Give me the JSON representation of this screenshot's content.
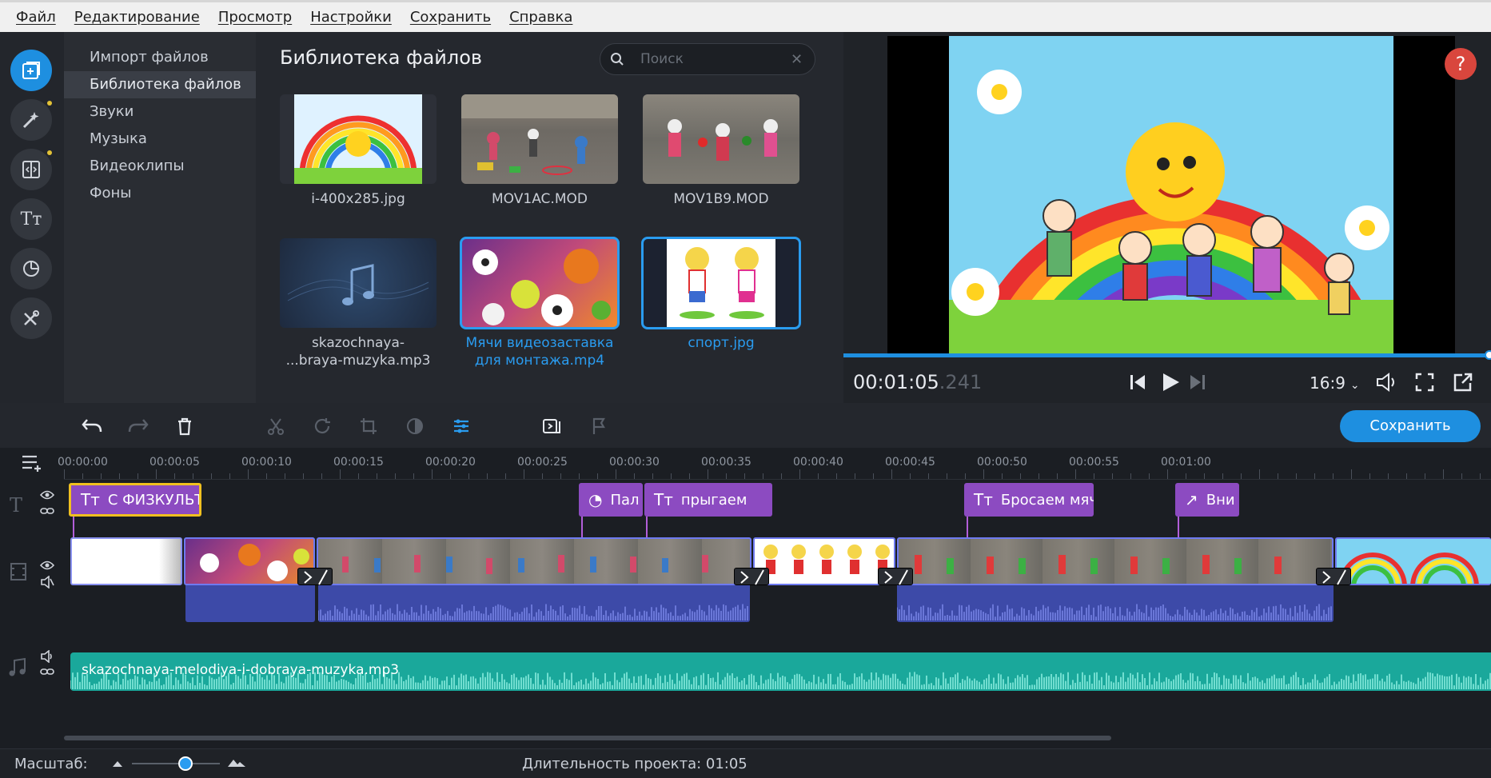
{
  "menu": [
    "Файл",
    "Редактирование",
    "Просмотр",
    "Настройки",
    "Сохранить",
    "Справка"
  ],
  "categories": [
    "Импорт файлов",
    "Библиотека файлов",
    "Звуки",
    "Музыка",
    "Видеоклипы",
    "Фоны"
  ],
  "icons": [
    "import-icon",
    "magic-wand-icon",
    "transitions-icon",
    "titles-icon",
    "stickers-icon",
    "tools-icon"
  ],
  "library": {
    "title": "Библиотека файлов",
    "search_placeholder": "Поиск",
    "files": [
      {
        "name": "i-400x285.jpg",
        "selected": false
      },
      {
        "name": "MOV1AC.MOD",
        "selected": false
      },
      {
        "name": "MOV1B9.MOD",
        "selected": false
      },
      {
        "name_line1": "skazochnaya-",
        "name_line2": "...braya-muzyka.mp3",
        "selected": false
      },
      {
        "name_line1": "Мячи видеозаставка",
        "name_line2": "для монтажа.mp4",
        "selected": true
      },
      {
        "name": "спорт.jpg",
        "selected": true
      }
    ]
  },
  "preview": {
    "help": "?",
    "timecode": "00:01:05",
    "timecode_ms": ".241",
    "aspect": "16:9",
    "progress": 1.0
  },
  "toolbar": {
    "save_label": "Сохранить"
  },
  "ruler": [
    "00:00:00",
    "00:00:05",
    "00:00:10",
    "00:00:15",
    "00:00:20",
    "00:00:25",
    "00:00:30",
    "00:00:35",
    "00:00:40",
    "00:00:45",
    "00:00:50",
    "00:00:55",
    "00:01:00"
  ],
  "title_clips": [
    {
      "label": "С ФИЗКУЛЬТ",
      "glyph": "Тт",
      "selected": true
    },
    {
      "label": "Пал",
      "glyph": "◔",
      "selected": false
    },
    {
      "label": "прыгаем",
      "glyph": "Тт",
      "selected": false
    },
    {
      "label": "Бросаем мяч",
      "glyph": "Тт",
      "selected": false
    },
    {
      "label": "Вни",
      "glyph": "↗",
      "selected": false
    }
  ],
  "music_track": {
    "label": "skazochnaya-melodiya-i-dobraya-muzyka.mp3"
  },
  "status": {
    "zoom_label": "Масштаб:",
    "duration": "Длительность проекта: 01:05"
  },
  "colors": {
    "accent": "#1e8fe0",
    "title_clip": "#8c4bc1",
    "music_clip": "#1aa89b",
    "audio_clip": "#3d4aa8",
    "help": "#d9463d"
  }
}
